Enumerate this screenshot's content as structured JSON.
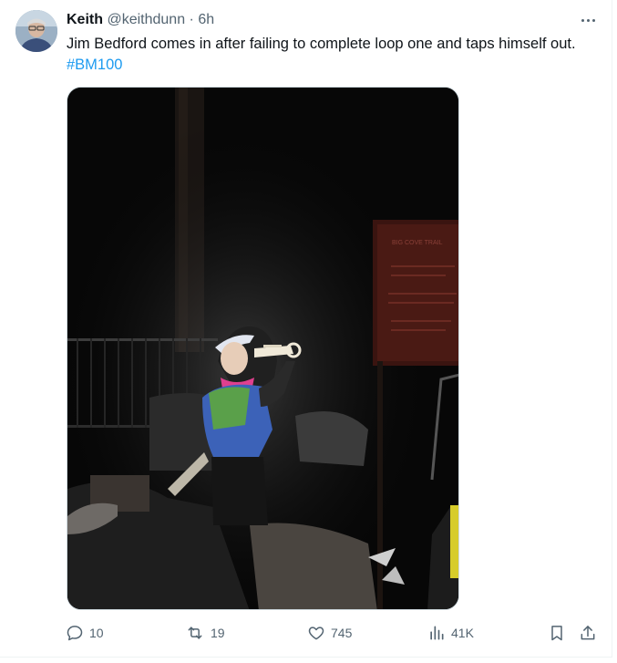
{
  "author": {
    "name": "Keith",
    "handle": "@keithdunn",
    "separator": "·",
    "time": "6h"
  },
  "tweet": {
    "text": "Jim Bedford comes in after failing to complete loop one and taps himself out. ",
    "hashtag": "#BM100"
  },
  "media": {
    "sign_text": "BIG COVE TRAIL"
  },
  "actions": {
    "replies": "10",
    "retweets": "19",
    "likes": "745",
    "views": "41K"
  },
  "colors": {
    "link": "#1d9bf0",
    "secondary_text": "#536471",
    "primary_text": "#0f1419"
  },
  "icons": [
    "more-icon",
    "reply-icon",
    "retweet-icon",
    "like-icon",
    "views-icon",
    "bookmark-icon",
    "share-icon"
  ]
}
